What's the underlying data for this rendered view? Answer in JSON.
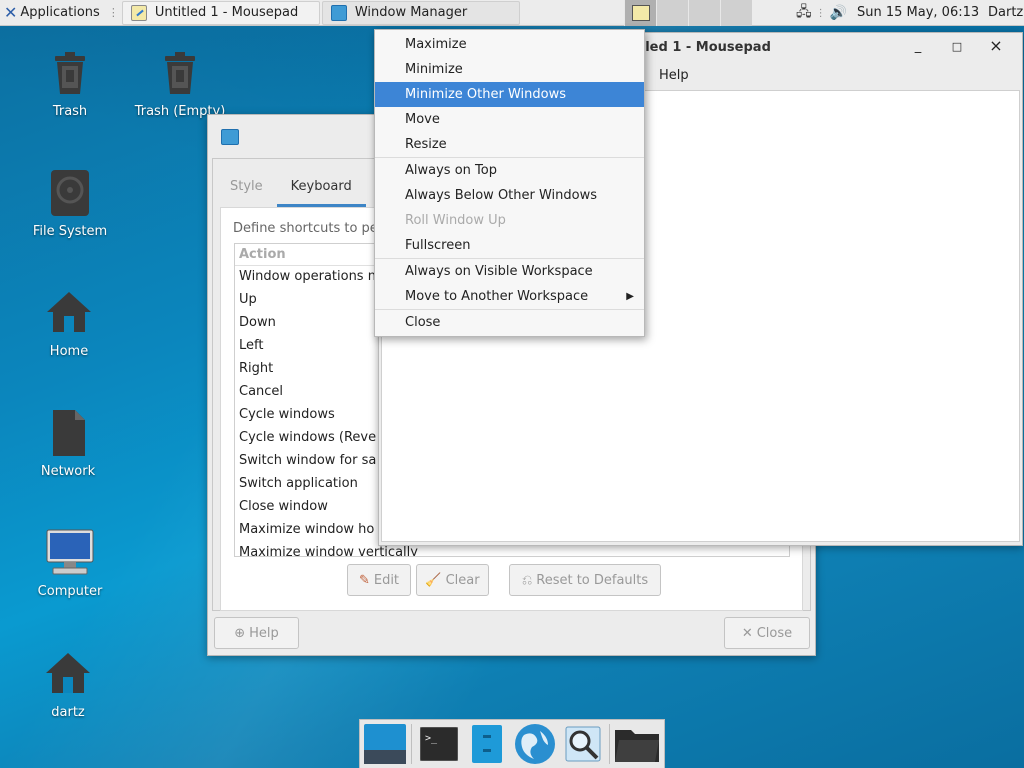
{
  "top_panel": {
    "applications_label": "Applications",
    "tasks": [
      {
        "label": "Untitled 1 - Mousepad",
        "icon": "mousepad-icon"
      },
      {
        "label": "Window Manager",
        "icon": "window-manager-icon"
      }
    ],
    "clock": "Sun 15 May, 06:13",
    "user": "Dartz"
  },
  "desktop_icons": [
    {
      "label": "Trash",
      "icon": "trash-icon"
    },
    {
      "label": "Trash (Empty)",
      "icon": "trash-empty-icon"
    },
    {
      "label": "File System",
      "icon": "drive-icon"
    },
    {
      "label": "Home",
      "icon": "home-icon"
    },
    {
      "label": "Network",
      "icon": "network-icon"
    },
    {
      "label": "Computer",
      "icon": "computer-icon"
    },
    {
      "label": "dartz",
      "icon": "home-folder-icon"
    }
  ],
  "mousepad": {
    "title": "tled 1 - Mousepad",
    "menu_help": "Help",
    "controls": {
      "minimize": "_",
      "maximize": "□",
      "close": "×"
    }
  },
  "settings": {
    "tabs": [
      "Style",
      "Keyboard"
    ],
    "active_tab": "Keyboard",
    "description": "Define shortcuts to pe",
    "list_header": "Action",
    "rows": [
      "Window operations n",
      "Up",
      "Down",
      "Left",
      "Right",
      "Cancel",
      "Cycle windows",
      "Cycle windows (Reve",
      "Switch window for sa",
      "Switch application",
      "Close window",
      "Maximize window ho",
      "Maximize window vertically"
    ],
    "buttons": {
      "edit": "Edit",
      "clear": "Clear",
      "reset": "Reset to Defaults",
      "help": "Help",
      "close": "Close"
    }
  },
  "context_menu": {
    "items": [
      {
        "label": "Maximize",
        "state": "normal"
      },
      {
        "label": "Minimize",
        "state": "normal"
      },
      {
        "label": "Minimize Other Windows",
        "state": "highlighted"
      },
      {
        "label": "Move",
        "state": "normal"
      },
      {
        "label": "Resize",
        "state": "normal"
      },
      {
        "label": "Always on Top",
        "state": "normal"
      },
      {
        "label": "Always Below Other Windows",
        "state": "normal"
      },
      {
        "label": "Roll Window Up",
        "state": "disabled"
      },
      {
        "label": "Fullscreen",
        "state": "normal"
      },
      {
        "label": "Always on Visible Workspace",
        "state": "normal"
      },
      {
        "label": "Move to Another Workspace",
        "state": "submenu"
      },
      {
        "label": "Close",
        "state": "normal"
      }
    ]
  },
  "dock": {
    "items": [
      "show-desktop-icon",
      "terminal-icon",
      "file-manager-icon",
      "web-browser-icon",
      "app-finder-icon",
      "folder-icon"
    ]
  },
  "colors": {
    "highlight": "#3d85d6",
    "desktop": "#0a86bd",
    "panel": "#ececec"
  }
}
